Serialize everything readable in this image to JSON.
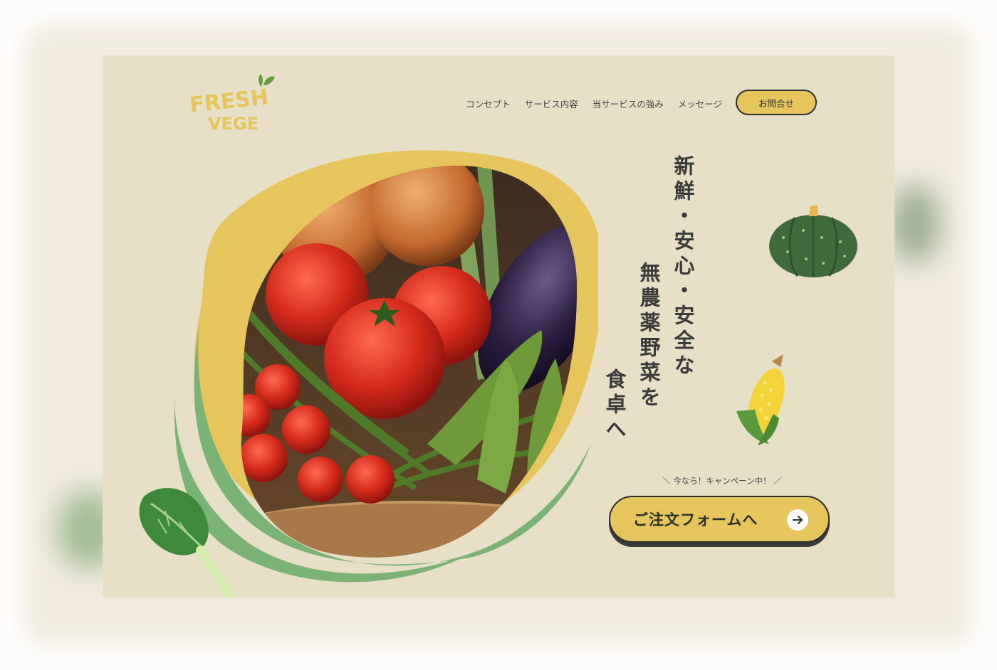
{
  "logo": {
    "line1": "FRESH",
    "line2": "VEGE"
  },
  "nav": {
    "items": [
      "コンセプト",
      "サービス内容",
      "当サービスの強み",
      "メッセージ"
    ],
    "contact_label": "お問合せ"
  },
  "headline": {
    "col1": "新鮮・安心・安全な",
    "col2": "無農薬野菜を",
    "col3": "食卓へ"
  },
  "campaign_text": "＼ 今なら！キャンペーン中！ ／",
  "cta": {
    "label": "ご注文フォームへ"
  },
  "icons": {
    "hero": "vegetable-basket-photo",
    "pumpkin": "pumpkin-icon",
    "corn": "corn-icon",
    "spinach": "spinach-icon",
    "arrow": "arrow-right-icon",
    "leaf": "leaf-icon"
  },
  "colors": {
    "background": "#e8dfc7",
    "accent_yellow": "#e6c55d",
    "accent_green": "#7bb374",
    "text": "#3a3a3a"
  }
}
